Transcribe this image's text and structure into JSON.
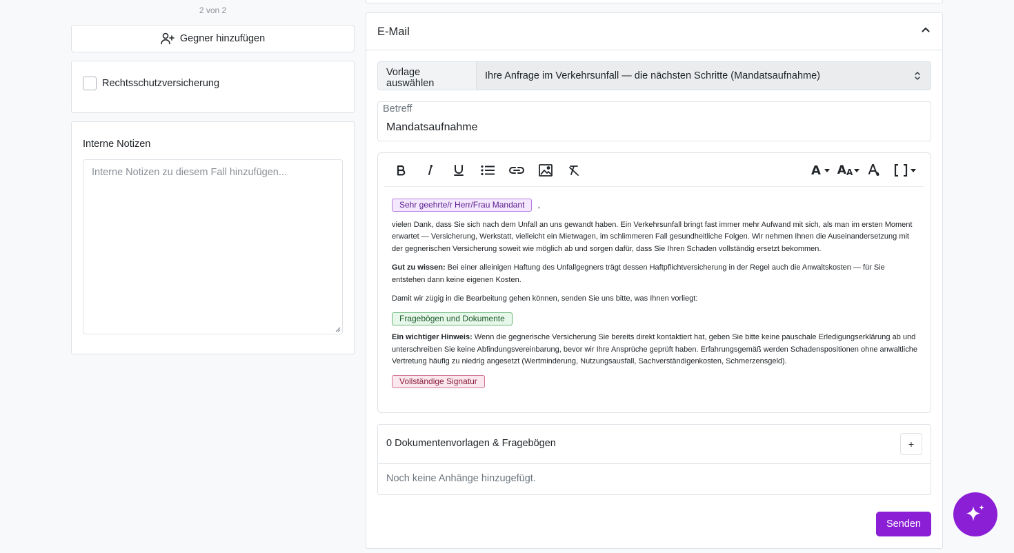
{
  "left": {
    "pager": "2 von 2",
    "add_opponent_label": "Gegner hinzufügen",
    "insurance_label": "Rechtsschutzversicherung",
    "insurance_checked": false,
    "notes_title": "Interne Notizen",
    "notes_placeholder": "Interne Notizen zu diesem Fall hinzufügen..."
  },
  "email": {
    "title": "E-Mail",
    "template_label": "Vorlage auswählen",
    "template_value": "Ihre Anfrage im Verkehrsunfall — die nächsten Schritte (Mandatsaufnahme)",
    "subject_label": "Betreff",
    "subject_value": "Mandatsaufnahme",
    "toolbar": {
      "bold": "bold-icon",
      "italic": "italic-icon",
      "underline": "underline-icon",
      "list": "bullet-list-icon",
      "link": "link-icon",
      "image": "image-icon",
      "clear": "clear-format-icon",
      "font": "font-icon",
      "font_size": "font-size-icon",
      "color": "text-color-icon",
      "brackets": "brackets-icon"
    },
    "body": {
      "salutation_chip": "Sehr geehrte/r Herr/Frau Mandant",
      "salutation_suffix": ",",
      "para1": "vielen Dank, dass Sie sich nach dem Unfall an uns gewandt haben. Ein Verkehrsunfall bringt fast immer mehr Aufwand mit sich, als man im ersten Moment erwartet — Versicherung, Werkstatt, vielleicht ein Mietwagen, im schlimmeren Fall gesundheitliche Folgen. Wir nehmen Ihnen die Auseinandersetzung mit der gegnerischen Versicherung soweit wie möglich ab und sorgen dafür, dass Sie Ihren Schaden vollständig ersetzt bekommen.",
      "para2_bold": "Gut zu wissen:",
      "para2": " Bei einer alleinigen Haftung des Unfallgegners trägt dessen Haftpflichtversicherung in der Regel auch die Anwaltskosten — für Sie entstehen dann keine eigenen Kosten.",
      "para3": "Damit wir zügig in die Bearbeitung gehen können, senden Sie uns bitte, was Ihnen vorliegt:",
      "docs_chip": "Fragebögen und Dokumente",
      "para4_bold": "Ein wichtiger Hinweis:",
      "para4": " Wenn die gegnerische Versicherung Sie bereits direkt kontaktiert hat, geben Sie bitte keine pauschale Erledigungserklärung ab und unterschreiben Sie keine Abfindungsvereinbarung, bevor wir Ihre Ansprüche geprüft haben. Erfahrungsgemäß werden Schadenspositionen ohne anwaltliche Vertretung häufig zu niedrig angesetzt (Wertminderung, Nutzungsausfall, Sachverständigenkosten, Schmerzensgeld).",
      "signature_chip": "Vollständige Signatur"
    },
    "attachments_title": "0 Dokumentenvorlagen & Fragebögen",
    "attachments_add": "+",
    "attachments_empty": "Noch keine Anhänge hinzugefügt.",
    "send_label": "Senden"
  },
  "fab_icon": "sparkles-icon",
  "colors": {
    "accent": "#8b1fd6",
    "border": "#dee2e6",
    "background": "#f8f9fa"
  }
}
